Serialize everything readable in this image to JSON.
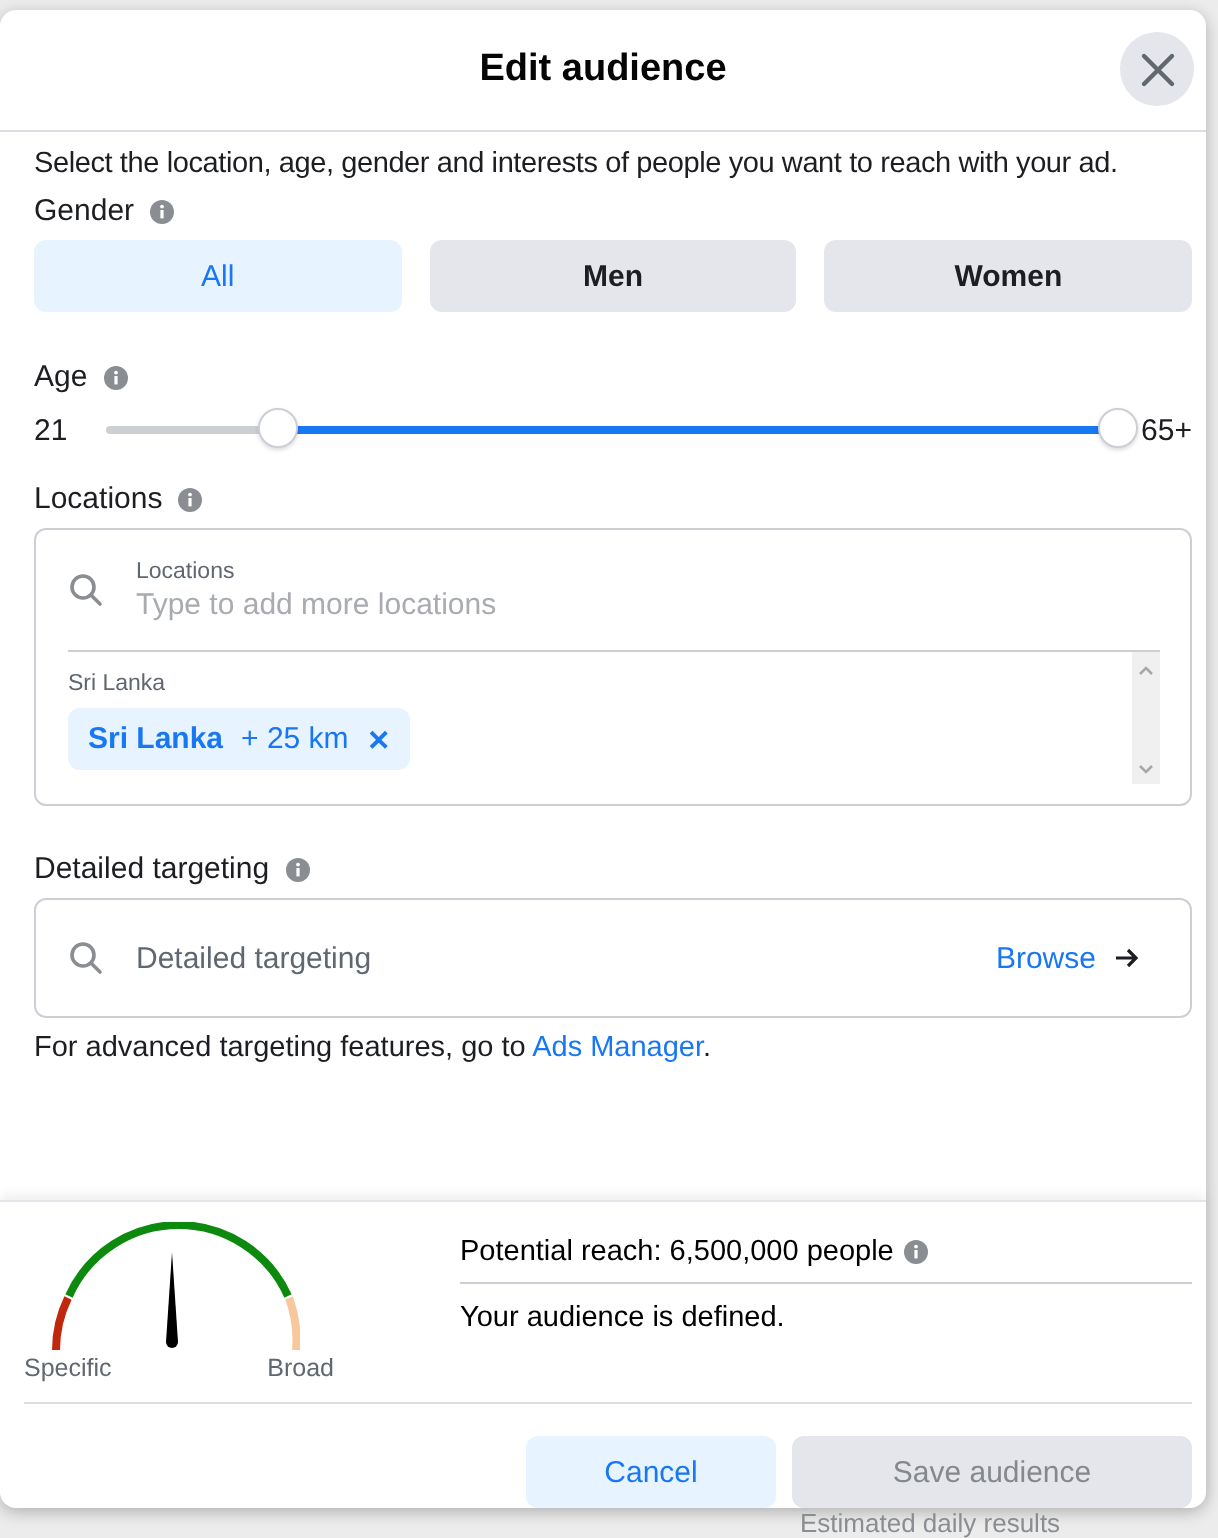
{
  "dialog": {
    "title": "Edit audience",
    "intro": "Select the location, age, gender and interests of people you want to reach with your ad."
  },
  "gender": {
    "label": "Gender",
    "options": [
      {
        "label": "All",
        "selected": true
      },
      {
        "label": "Men",
        "selected": false
      },
      {
        "label": "Women",
        "selected": false
      }
    ]
  },
  "age": {
    "label": "Age",
    "min_reading": "21",
    "max_reading": "65+",
    "thumbs": [
      {
        "level": 0.17
      },
      {
        "level": 1
      }
    ]
  },
  "locations": {
    "label": "Locations",
    "field_label": "Locations",
    "placeholder": "Type to add more locations",
    "group_label": "Sri Lanka",
    "chips": [
      {
        "name": "Sri Lanka",
        "radius": "+ 25 km",
        "remove": "✕"
      }
    ]
  },
  "detailed_targeting": {
    "label": "Detailed targeting",
    "placeholder": "Detailed targeting",
    "browse": "Browse",
    "note": "For advanced targeting features, go to",
    "link": "Ads Manager",
    "note_end": "."
  },
  "audience_gauge": {
    "left_label": "Specific",
    "right_label": "Broad"
  },
  "reach": {
    "text": "Potential reach: 6,500,000 people",
    "status": "Your audience is defined."
  },
  "buttons": [
    {
      "label": "Cancel",
      "kind": "secondary",
      "disabled": false
    },
    {
      "label": "Save audience",
      "kind": "primary",
      "disabled": true
    }
  ],
  "background": {
    "text": "Estimated daily results"
  }
}
